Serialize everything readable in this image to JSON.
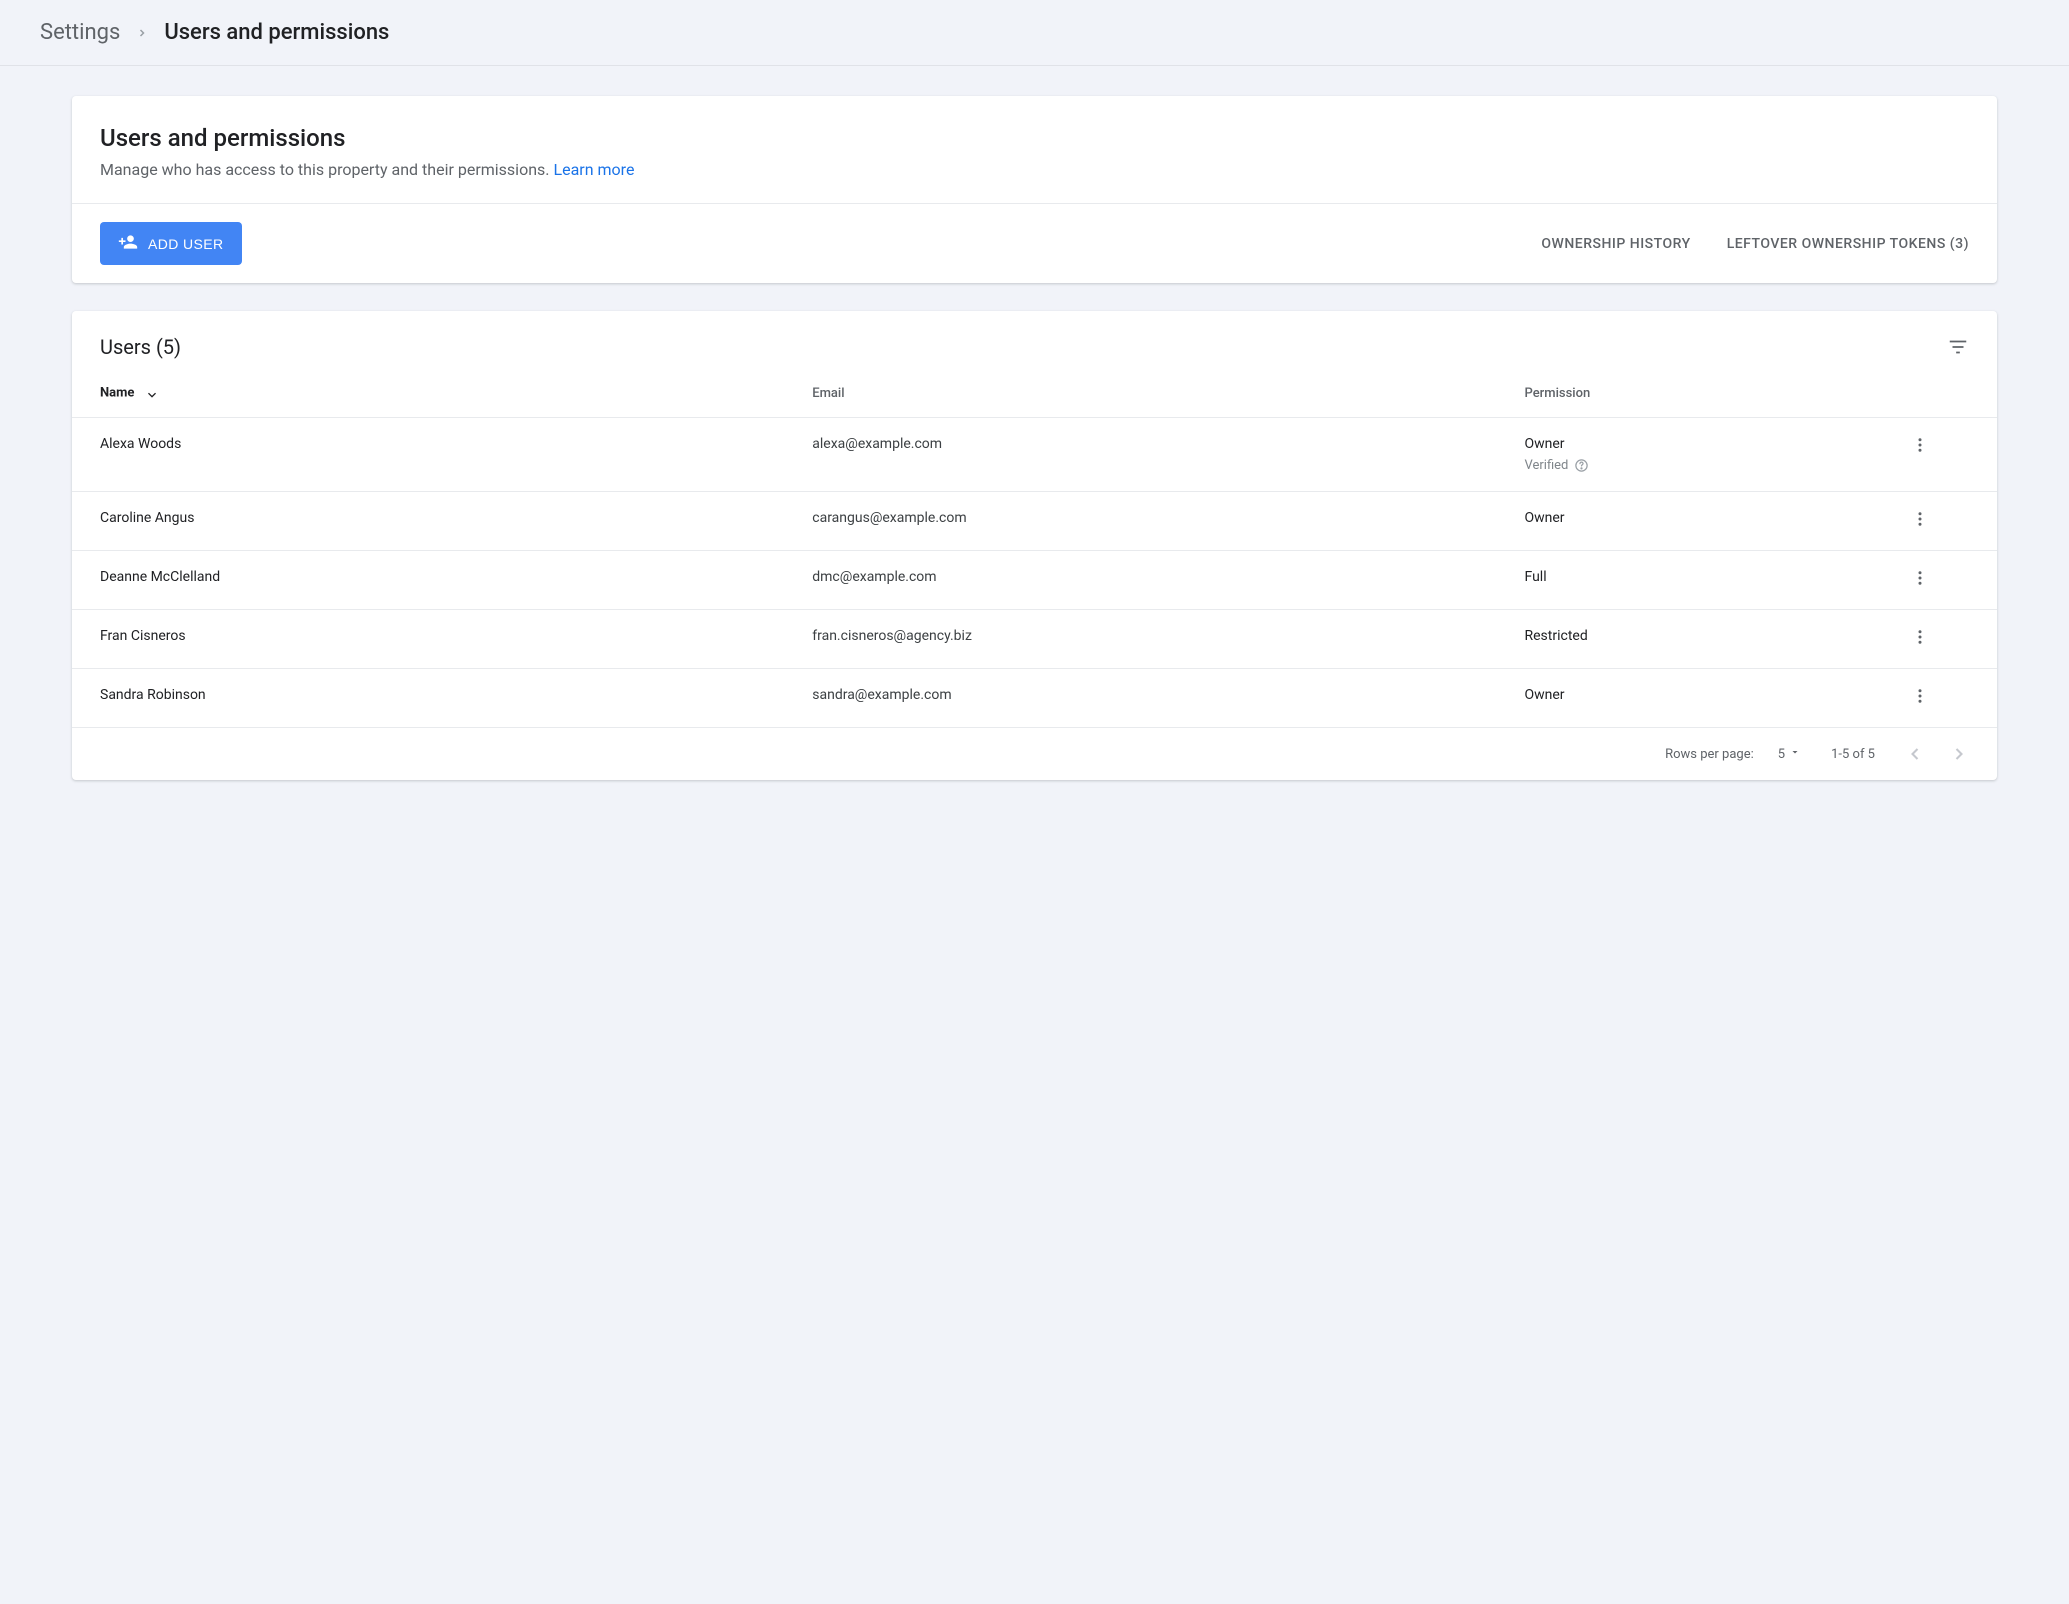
{
  "breadcrumb": {
    "root": "Settings",
    "current": "Users and permissions"
  },
  "header_card": {
    "title": "Users and permissions",
    "subtitle_text": "Manage who has access to this property and their permissions. ",
    "learn_more": "Learn more",
    "add_user_label": "ADD USER",
    "ownership_history_label": "OWNERSHIP HISTORY",
    "leftover_tokens_label": "LEFTOVER OWNERSHIP TOKENS (3)"
  },
  "users_table": {
    "title": "Users (5)",
    "columns": {
      "name": "Name",
      "email": "Email",
      "permission": "Permission"
    },
    "verified_label": "Verified",
    "rows": [
      {
        "name": "Alexa Woods",
        "email": "alexa@example.com",
        "permission": "Owner",
        "verified": true
      },
      {
        "name": "Caroline Angus",
        "email": "carangus@example.com",
        "permission": "Owner",
        "verified": false
      },
      {
        "name": "Deanne McClelland",
        "email": "dmc@example.com",
        "permission": "Full",
        "verified": false
      },
      {
        "name": "Fran Cisneros",
        "email": "fran.cisneros@agency.biz",
        "permission": "Restricted",
        "verified": false
      },
      {
        "name": "Sandra Robinson",
        "email": "sandra@example.com",
        "permission": "Owner",
        "verified": false
      }
    ]
  },
  "pagination": {
    "rows_per_page_label": "Rows per page:",
    "rows_per_page_value": "5",
    "range_label": "1-5 of 5"
  }
}
